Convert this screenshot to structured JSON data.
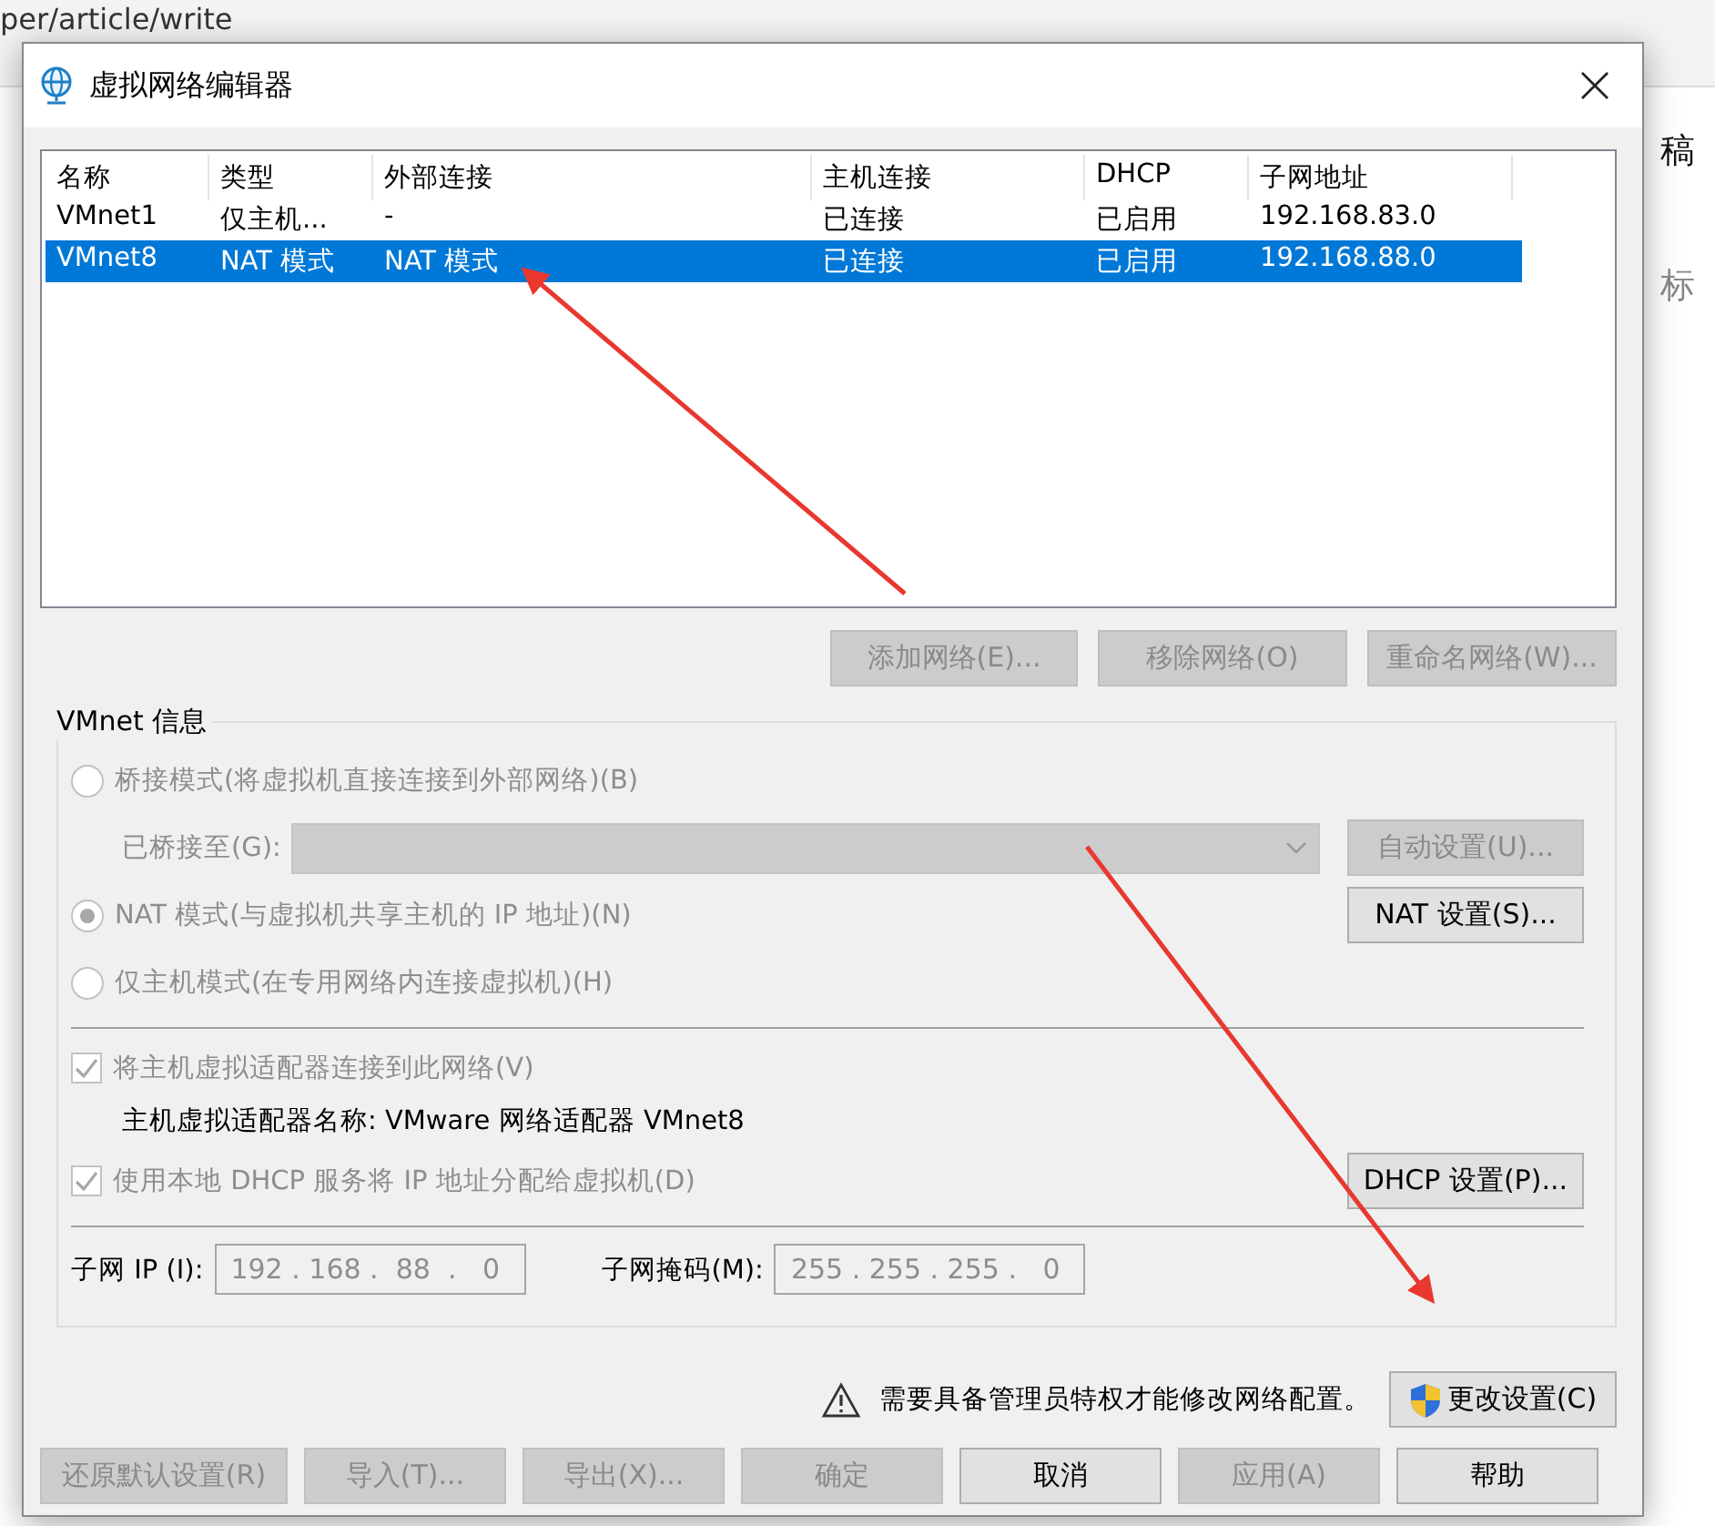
{
  "background_page": {
    "url_fragment": "per/article/write",
    "right_fragments": [
      "稿",
      "标"
    ]
  },
  "window": {
    "title": "虚拟网络编辑器"
  },
  "network_table": {
    "columns": [
      "名称",
      "类型",
      "外部连接",
      "主机连接",
      "DHCP",
      "子网地址"
    ],
    "rows": [
      {
        "cells": [
          "VMnet1",
          "仅主机...",
          "-",
          "已连接",
          "已启用",
          "192.168.83.0"
        ],
        "selected": false
      },
      {
        "cells": [
          "VMnet8",
          "NAT 模式",
          "NAT 模式",
          "已连接",
          "已启用",
          "192.168.88.0"
        ],
        "selected": true
      }
    ]
  },
  "table_buttons": [
    {
      "label": "添加网络(E)...",
      "disabled": true
    },
    {
      "label": "移除网络(O)",
      "disabled": true
    },
    {
      "label": "重命名网络(W)...",
      "disabled": true
    }
  ],
  "vmnet_info": {
    "title": "VMnet 信息",
    "bridged_mode": {
      "label": "桥接模式(将虚拟机直接连接到外部网络)(B)",
      "selected": false,
      "disabled": true
    },
    "bridged_to": {
      "label": "已桥接至(G):",
      "disabled": true
    },
    "auto_button": {
      "label": "自动设置(U)...",
      "disabled": true
    },
    "nat_mode": {
      "label": "NAT 模式(与虚拟机共享主机的 IP 地址)(N)",
      "selected": true,
      "disabled": true
    },
    "nat_button": {
      "label": "NAT 设置(S)...",
      "disabled": false
    },
    "host_only_mode": {
      "label": "仅主机模式(在专用网络内连接虚拟机)(H)",
      "selected": false,
      "disabled": true
    },
    "connect_adapter": {
      "label": "将主机虚拟适配器连接到此网络(V)",
      "checked": true,
      "disabled": true
    },
    "adapter_name": "主机虚拟适配器名称: VMware 网络适配器 VMnet8",
    "use_dhcp": {
      "label": "使用本地 DHCP 服务将 IP 地址分配给虚拟机(D)",
      "checked": true,
      "disabled": true
    },
    "dhcp_button": {
      "label": "DHCP 设置(P)...",
      "disabled": false
    },
    "subnet_ip": {
      "label": "子网 IP (I):",
      "value": "192 . 168 .  88  .   0",
      "disabled": true
    },
    "subnet_mask": {
      "label": "子网掩码(M):",
      "value": "255 . 255 . 255 .   0",
      "disabled": true
    }
  },
  "notice": {
    "text": "需要具备管理员特权才能修改网络配置。"
  },
  "change_button": {
    "label": "更改设置(C)",
    "disabled": false
  },
  "footer_buttons": [
    {
      "label": "还原默认设置(R)",
      "disabled": true
    },
    {
      "label": "导入(T)...",
      "disabled": true
    },
    {
      "label": "导出(X)...",
      "disabled": true
    },
    {
      "label": "确定",
      "disabled": true
    },
    {
      "label": "取消",
      "disabled": false
    },
    {
      "label": "应用(A)",
      "disabled": true
    },
    {
      "label": "帮助",
      "disabled": false
    }
  ]
}
